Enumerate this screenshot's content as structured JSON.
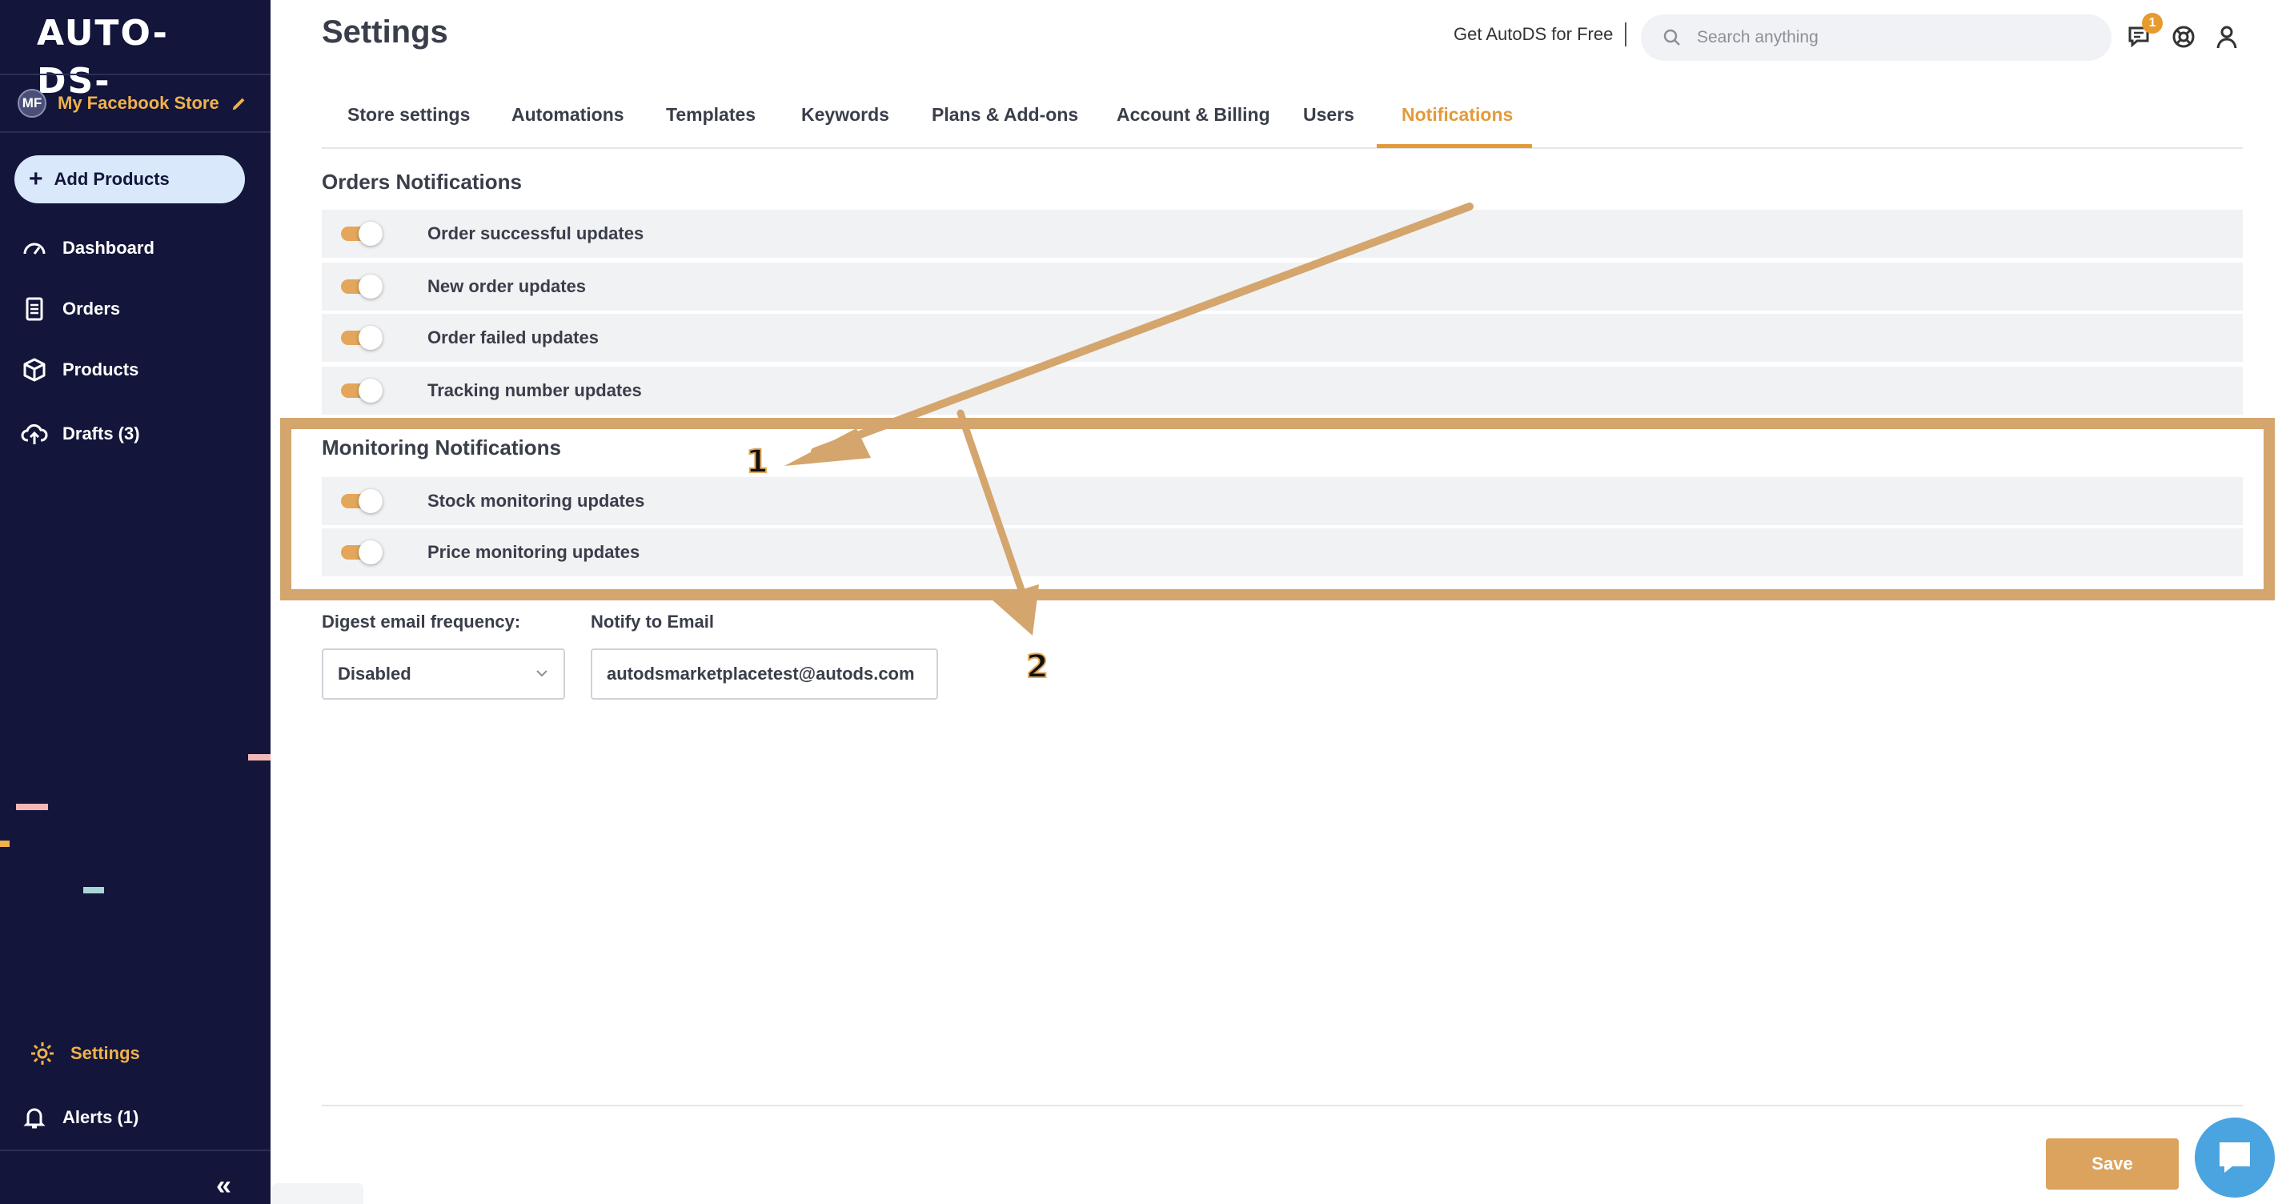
{
  "sidebar": {
    "logo": "AUTO-DS-",
    "store": {
      "initials": "MF",
      "name": "My Facebook Store"
    },
    "add_button": "Add Products",
    "nav": [
      {
        "label": "Dashboard",
        "icon": "dashboard-gauge-icon"
      },
      {
        "label": "Orders",
        "icon": "orders-document-icon"
      },
      {
        "label": "Products",
        "icon": "products-box-icon"
      },
      {
        "label": "Drafts (3)",
        "icon": "drafts-cloud-upload-icon"
      }
    ],
    "bottom_nav": [
      {
        "label": "Settings",
        "icon": "gear-icon",
        "active": true
      },
      {
        "label": "Alerts (1)",
        "icon": "bell-icon"
      }
    ],
    "collapse_glyph": "«"
  },
  "header": {
    "title": "Settings",
    "get_free": "Get AutoDS for Free",
    "search_placeholder": "Search anything",
    "notification_badge": "1"
  },
  "tabs": [
    {
      "label": "Store settings"
    },
    {
      "label": "Automations"
    },
    {
      "label": "Templates"
    },
    {
      "label": "Keywords"
    },
    {
      "label": "Plans & Add-ons"
    },
    {
      "label": "Account & Billing"
    },
    {
      "label": "Users"
    },
    {
      "label": "Notifications",
      "active": true
    }
  ],
  "orders_section": {
    "title": "Orders Notifications",
    "items": [
      {
        "label": "Order successful updates",
        "enabled": true
      },
      {
        "label": "New order updates",
        "enabled": true
      },
      {
        "label": "Order failed updates",
        "enabled": true
      },
      {
        "label": "Tracking number updates",
        "enabled": true
      }
    ]
  },
  "monitoring_section": {
    "title": "Monitoring Notifications",
    "items": [
      {
        "label": "Stock monitoring updates",
        "enabled": true
      },
      {
        "label": "Price monitoring updates",
        "enabled": true
      }
    ]
  },
  "digest": {
    "label": "Digest email frequency:",
    "value": "Disabled"
  },
  "notify_email": {
    "label": "Notify to Email",
    "value": "autodsmarketplacetest@autods.com"
  },
  "save_button": "Save",
  "annotations": {
    "step1": "1",
    "step2": "2"
  },
  "colors": {
    "sidebar_bg": "#13163a",
    "accent": "#e39a3b",
    "toggle_on": "#e3a65a",
    "annotation": "#d4a56d",
    "chat": "#4aa4e0"
  }
}
